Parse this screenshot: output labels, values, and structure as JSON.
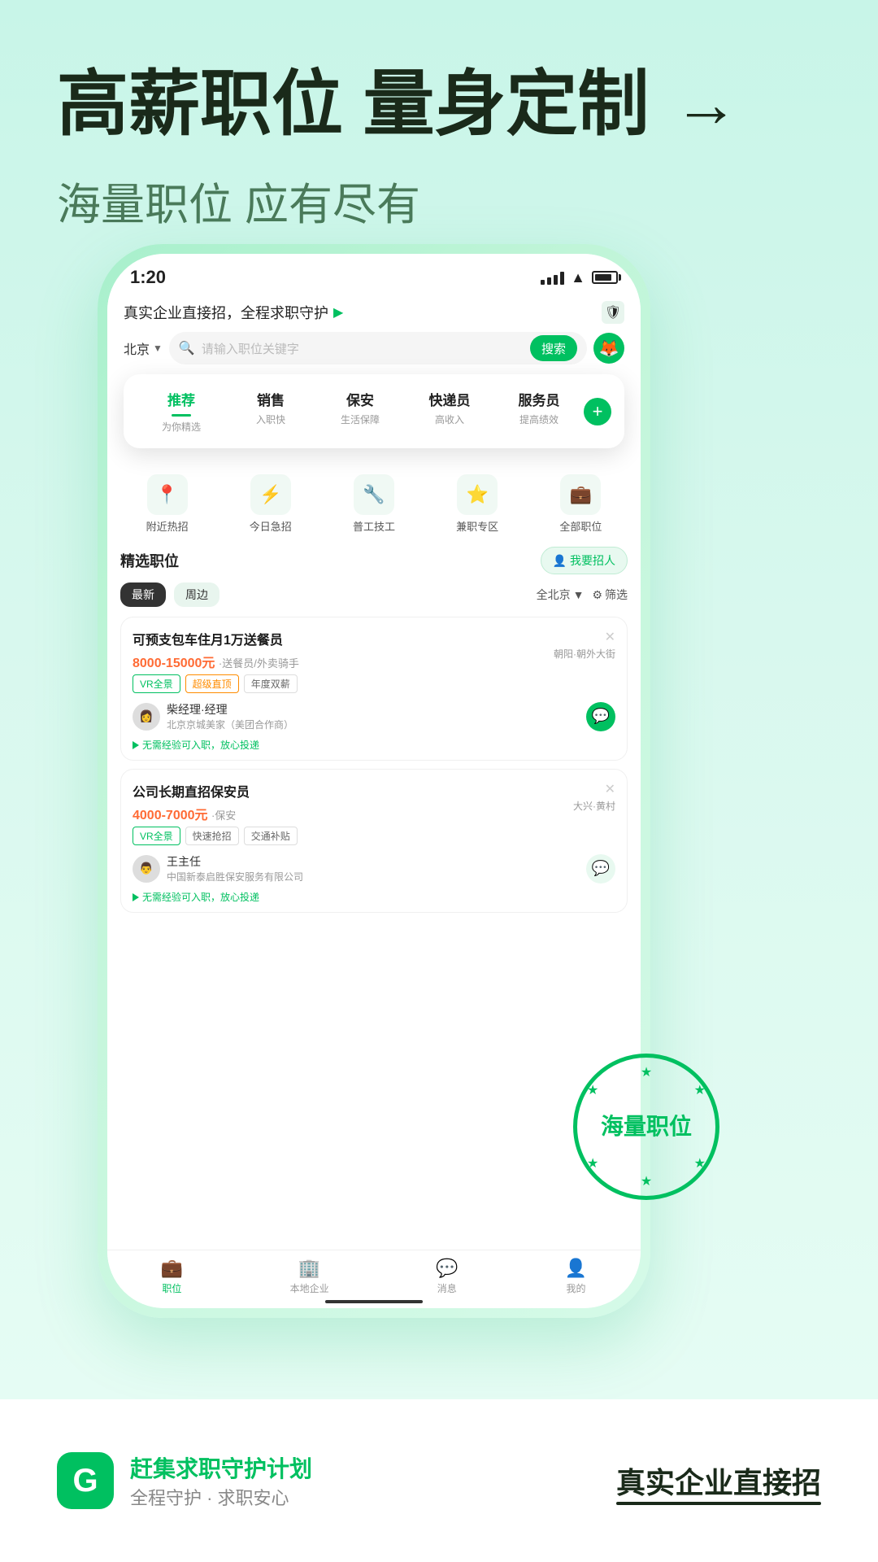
{
  "header": {
    "main_title": "高薪职位 量身定制",
    "sub_title": "海量职位 应有尽有"
  },
  "phone": {
    "status": {
      "time": "1:20"
    },
    "app_tagline": "真实企业直接招，全程求职守护",
    "location": "北京",
    "search_placeholder": "请输入职位关键字",
    "search_btn": "搜索",
    "categories": [
      {
        "label": "推荐",
        "sub": "为你精选",
        "active": true
      },
      {
        "label": "销售",
        "sub": "入职快",
        "active": false
      },
      {
        "label": "保安",
        "sub": "生活保障",
        "active": false
      },
      {
        "label": "快递员",
        "sub": "高收入",
        "active": false
      },
      {
        "label": "服务员",
        "sub": "提高绩效",
        "active": false
      }
    ],
    "quick_nav": [
      {
        "icon": "📍",
        "label": "附近热招"
      },
      {
        "icon": "⚡",
        "label": "今日急招"
      },
      {
        "icon": "🔧",
        "label": "普工技工"
      },
      {
        "icon": "⭐",
        "label": "兼职专区"
      },
      {
        "icon": "💼",
        "label": "全部职位"
      }
    ],
    "jobs_title": "精选职位",
    "hire_btn": "我要招人",
    "filter_tags": [
      {
        "label": "最新",
        "active": true
      },
      {
        "label": "周边",
        "active": false
      }
    ],
    "filter_region": "全北京",
    "filter_label": "筛选",
    "job_cards": [
      {
        "title": "可预支包车住月1万送餐员",
        "salary": "8000-15000元",
        "salary_suffix": "·送餐员/外卖骑手",
        "location": "朝阳·朝外大街",
        "tags": [
          "VR全景",
          "超级直顶",
          "年度双薪"
        ],
        "recruiter_name": "柴经理·经理",
        "company": "北京京城美家（美团合作商）",
        "apply_hint": "无需经验可入职，放心投递"
      },
      {
        "title": "公司长期直招保安员",
        "salary": "4000-7000元",
        "salary_suffix": "·保安",
        "location": "大兴·黄村",
        "tags": [
          "VR全景",
          "快速抢招",
          "交通补贴"
        ],
        "recruiter_name": "王主任",
        "company": "中国新泰启胜保安服务有限公司",
        "apply_hint": "无需经验可入职，放心投递"
      }
    ],
    "bottom_nav": [
      {
        "icon": "💼",
        "label": "职位",
        "active": true
      },
      {
        "icon": "🏢",
        "label": "本地企业",
        "active": false
      },
      {
        "icon": "💬",
        "label": "消息",
        "active": false
      },
      {
        "icon": "👤",
        "label": "我的",
        "active": false
      }
    ]
  },
  "stamp": {
    "text": "海量职位"
  },
  "footer": {
    "brand": "赶集求职守护计划",
    "slogan": "全程守护 · 求职安心",
    "tagline": "真实企业直接招"
  }
}
